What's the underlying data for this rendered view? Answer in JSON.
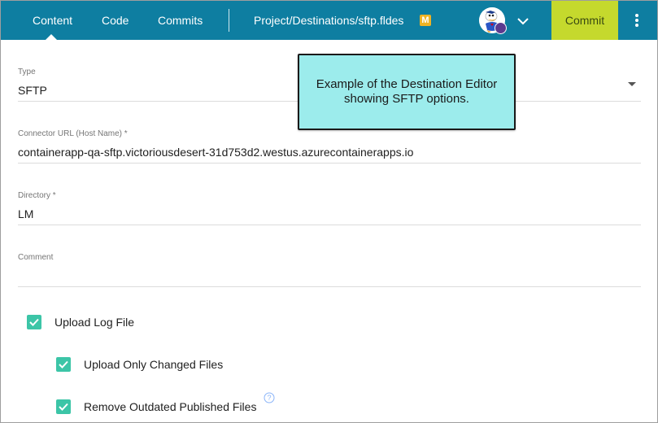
{
  "topbar": {
    "tabs": [
      {
        "label": "Content"
      },
      {
        "label": "Code"
      },
      {
        "label": "Commits"
      }
    ],
    "path": "Project/Destinations/sftp.fldes",
    "modified_badge": "M",
    "commit_label": "Commit",
    "colors": {
      "bar": "#0e7ea1",
      "commit": "#c5d92d",
      "badge": "#f0b323"
    }
  },
  "form": {
    "type": {
      "label": "Type",
      "value": "SFTP"
    },
    "connector_url": {
      "label": "Connector URL (Host Name) *",
      "value": "containerapp-qa-sftp.victoriousdesert-31d753d2.westus.azurecontainerapps.io"
    },
    "directory": {
      "label": "Directory *",
      "value": "LM"
    },
    "comment": {
      "label": "Comment",
      "value": ""
    },
    "checkboxes": [
      {
        "label": "Upload Log File",
        "checked": true
      },
      {
        "label": "Upload Only Changed Files",
        "checked": true
      },
      {
        "label": "Remove Outdated Published Files",
        "checked": true
      }
    ],
    "checkbox_color": "#3cc5a7"
  },
  "callout": {
    "text": "Example of the Destination Editor showing SFTP options."
  }
}
